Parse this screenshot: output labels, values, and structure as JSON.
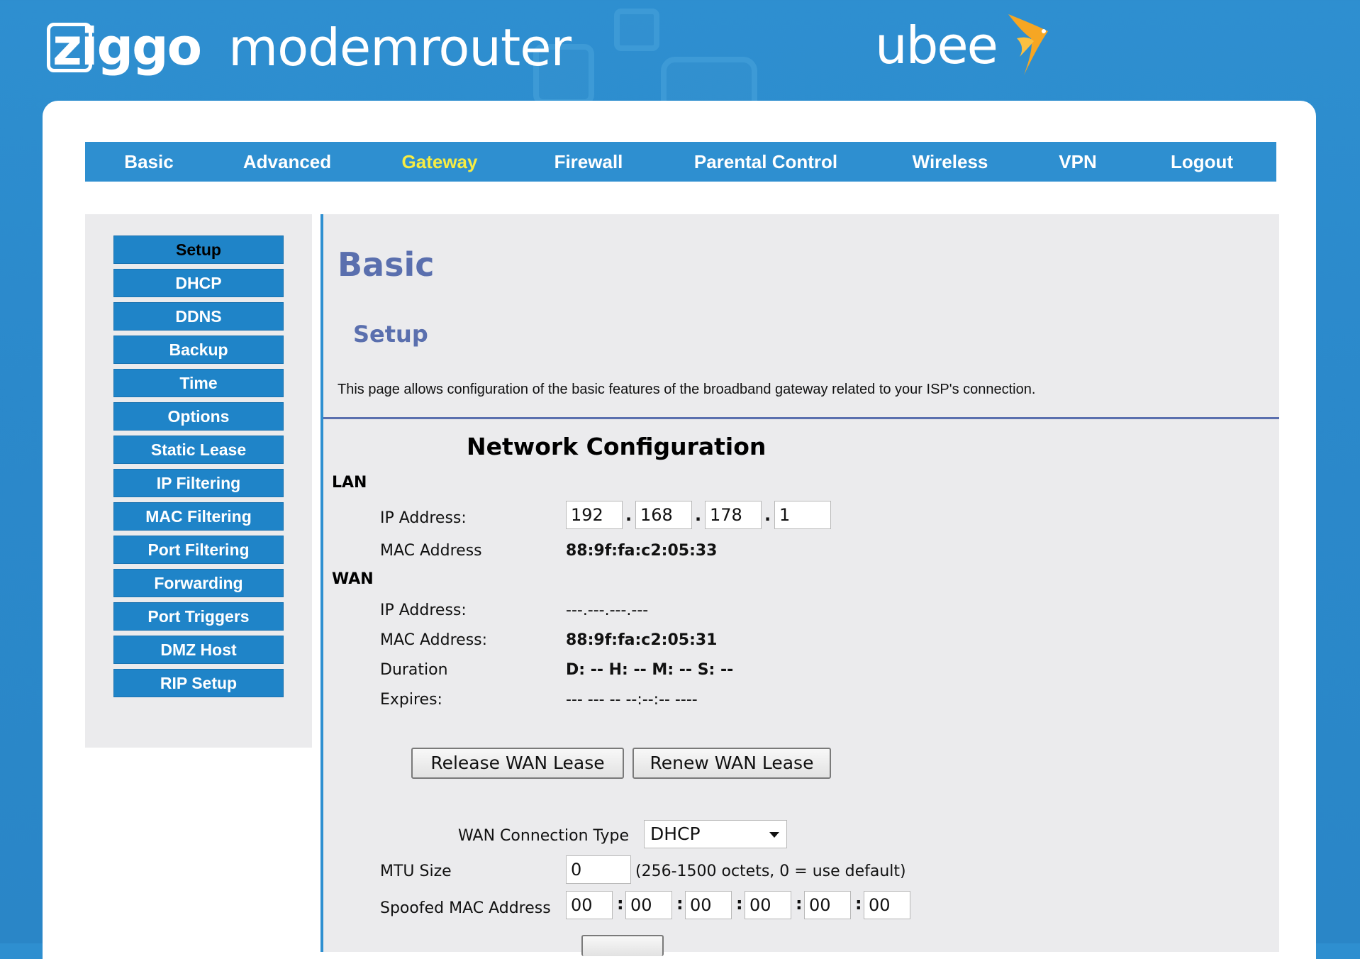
{
  "brand": {
    "logo_ziggo": "ziggo",
    "product": "modemrouter",
    "logo_ubee": "ubee"
  },
  "nav": {
    "tabs": [
      {
        "label": "Basic"
      },
      {
        "label": "Advanced"
      },
      {
        "label": "Gateway"
      },
      {
        "label": "Firewall"
      },
      {
        "label": "Parental Control"
      },
      {
        "label": "Wireless"
      },
      {
        "label": "VPN"
      },
      {
        "label": "Logout"
      }
    ],
    "active": "Gateway",
    "active_color": "#f6ec44"
  },
  "sidebar": {
    "items": [
      {
        "label": "Setup"
      },
      {
        "label": "DHCP"
      },
      {
        "label": "DDNS"
      },
      {
        "label": "Backup"
      },
      {
        "label": "Time"
      },
      {
        "label": "Options"
      },
      {
        "label": "Static Lease"
      },
      {
        "label": "IP Filtering"
      },
      {
        "label": "MAC Filtering"
      },
      {
        "label": "Port Filtering"
      },
      {
        "label": "Forwarding"
      },
      {
        "label": "Port Triggers"
      },
      {
        "label": "DMZ Host"
      },
      {
        "label": "RIP Setup"
      }
    ],
    "selected": "Setup"
  },
  "page": {
    "title": "Basic",
    "subtitle": "Setup",
    "description": "This page allows configuration of the basic features of the broadband gateway related to your ISP's connection."
  },
  "netconf": {
    "title": "Network Configuration",
    "lan": {
      "heading": "LAN",
      "ip_label": "IP Address:",
      "ip": [
        "192",
        "168",
        "178",
        "1"
      ],
      "mac_label": "MAC Address",
      "mac": "88:9f:fa:c2:05:33"
    },
    "wan": {
      "heading": "WAN",
      "ip_label": "IP Address:",
      "ip": "---.---.---.---",
      "mac_label": "MAC Address:",
      "mac": "88:9f:fa:c2:05:31",
      "duration_label": "Duration",
      "duration": "D: -- H: -- M: -- S: --",
      "expires_label": "Expires:",
      "expires": "--- --- -- --:--:-- ----"
    },
    "buttons": {
      "release": "Release WAN Lease",
      "renew": "Renew WAN Lease"
    },
    "conn_type_label": "WAN Connection Type",
    "conn_type": "DHCP",
    "mtu_label": "MTU Size",
    "mtu": "0",
    "mtu_hint": "(256-1500 octets, 0 = use default)",
    "spoofed_label": "Spoofed MAC Address",
    "spoofed": [
      "00",
      "00",
      "00",
      "00",
      "00",
      "00"
    ]
  },
  "colors": {
    "brand_blue": "#2e8fd0",
    "heading_blue": "#5a6fae",
    "menu_blue": "#1f84c8"
  }
}
